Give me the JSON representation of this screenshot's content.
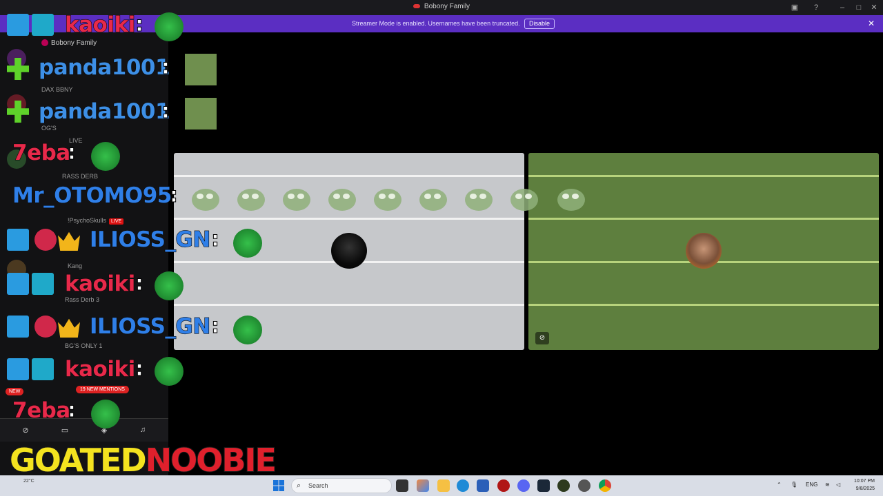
{
  "window": {
    "title": "Bobony Family"
  },
  "banner": {
    "message": "Streamer Mode is enabled. Usernames have been truncated.",
    "disable_label": "Disable",
    "close_icon": "close-icon"
  },
  "sidebar": {
    "server_name": "Bobony Family",
    "items": [
      {
        "label": "DAX",
        "tag": "BBNY"
      },
      {
        "label": "OG'S"
      },
      {
        "label": "LIVE"
      },
      {
        "label": "RASS DERB"
      },
      {
        "label": "!PsychoSkulls",
        "live": "LIVE"
      },
      {
        "label": "Kang"
      },
      {
        "label": "Rass Derb 3"
      },
      {
        "label": "BG'S ONLY 1"
      }
    ],
    "new_badge": "NEW",
    "mentions_badge": "19 NEW MENTIONS"
  },
  "chat": [
    {
      "user": "kaoiki",
      "color": "#e8294a",
      "badges": [
        "mod",
        "og"
      ],
      "emote": "frog"
    },
    {
      "user": "panda1001",
      "color": "#3d8fe6",
      "badges": [
        "plus"
      ],
      "emote": "photo"
    },
    {
      "user": "panda1001",
      "color": "#3d8fe6",
      "badges": [
        "plus"
      ],
      "emote": "photo"
    },
    {
      "user": "7eba",
      "color": "#e8294a",
      "badges": [],
      "emote": "frog"
    },
    {
      "user": "Mr_OTOMO95",
      "color": "#2f7fe8",
      "badges": [],
      "emote": ""
    },
    {
      "user": "ILIOSS_GN",
      "color": "#2f7fe8",
      "badges": [
        "mod",
        "star",
        "crown"
      ],
      "emote": "frog"
    },
    {
      "user": "kaoiki",
      "color": "#e8294a",
      "badges": [
        "mod",
        "og"
      ],
      "emote": "frog"
    },
    {
      "user": "ILIOSS_GN",
      "color": "#2f7fe8",
      "badges": [
        "mod",
        "star",
        "crown"
      ],
      "emote": "frog"
    },
    {
      "user": "kaoiki",
      "color": "#e8294a",
      "badges": [
        "mod",
        "og"
      ],
      "emote": "frog"
    },
    {
      "user": "7eba",
      "color": "#e8294a",
      "badges": [],
      "emote": "frog"
    }
  ],
  "chat_colon": ":",
  "logo": {
    "part1": "GOATED",
    "part2": "NOOBIE"
  },
  "taskbar": {
    "weather": "22°C",
    "search_placeholder": "Search",
    "lang": "ENG",
    "time": "10:07 PM",
    "date": "9/8/2025"
  },
  "colors": {
    "banner": "#5b2ec2",
    "left_tile": "#c6c8cb",
    "right_tile": "#5e7f3e"
  }
}
